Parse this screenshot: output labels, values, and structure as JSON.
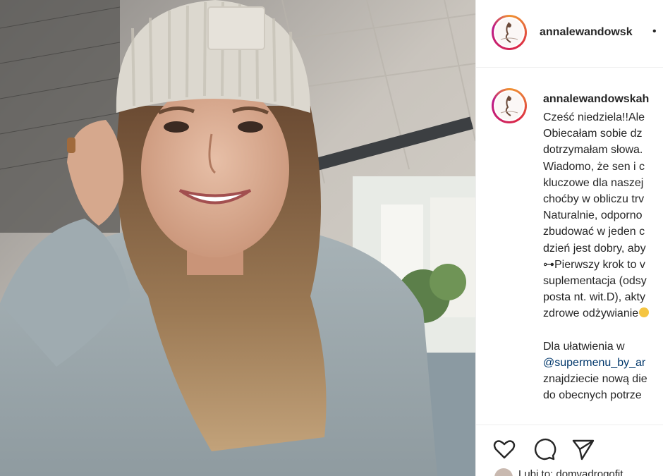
{
  "post": {
    "username": "annalewandowsk",
    "separator": "•"
  },
  "caption": {
    "username": "annalewandowskah",
    "lines": [
      "Cześć niedziela!!Ale",
      "Obiecałam sobie dz",
      "dotrzymałam słowa.",
      "Wiadomo, że sen i c",
      "kluczowe dla naszej",
      "choćby w obliczu trv",
      "Naturalnie, odporno",
      "zbudować w jeden c",
      "dzień jest dobry, aby",
      "⊶Pierwszy krok to v",
      "suplementacja (odsy",
      "posta nt. wit.D), akty",
      "zdrowe odżywianie"
    ],
    "paragraph2": [
      "Dla ułatwienia w",
      "@supermenu_by_ar",
      "znajdziecie nową die",
      "do obecnych potrze"
    ]
  },
  "actions": {
    "like_icon": "heart-icon",
    "comment_icon": "comment-icon",
    "share_icon": "share-icon"
  },
  "likes": {
    "text": "Lubi to: domvadrogofit"
  },
  "colors": {
    "text": "#262626",
    "mention": "#00376b",
    "border": "#efefef"
  }
}
